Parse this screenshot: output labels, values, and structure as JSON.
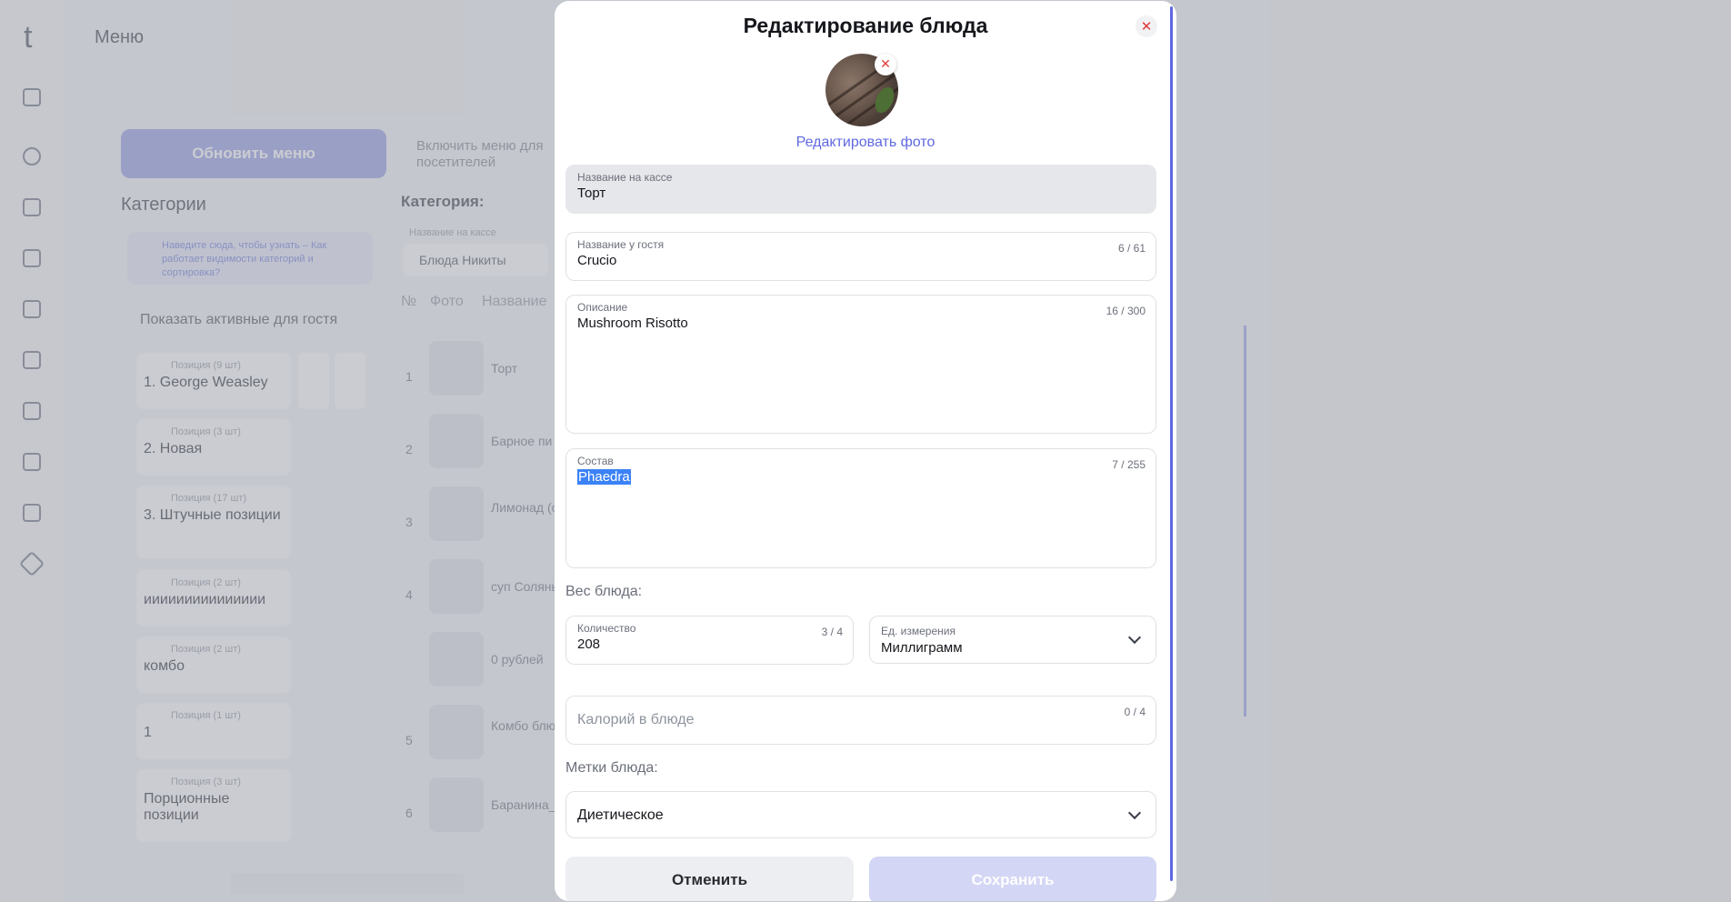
{
  "background": {
    "logo": "t",
    "page_title": "Меню",
    "refresh_button": "Обновить меню",
    "visitors_toggle_label": "Включить меню для посетителей",
    "categories_heading": "Категории",
    "category_heading": "Категория:",
    "hint_text": "Наведите сюда, чтобы узнать – Как работает видимости категорий и сортировка?",
    "show_active": "Показать активные для гостя",
    "categories": [
      {
        "sub": "Позиция (9 шт)",
        "name": "1. George Weasley"
      },
      {
        "sub": "Позиция (3 шт)",
        "name": "2. Новая"
      },
      {
        "sub": "Позиция (17 шт)",
        "name": "3. Штучные позиции"
      },
      {
        "sub": "Позиция (2 шт)",
        "name": "иииииииииииииии"
      },
      {
        "sub": "Позиция (2 шт)",
        "name": "комбо"
      },
      {
        "sub": "Позиция (1 шт)",
        "name": "1"
      },
      {
        "sub": "Позиция (3 шт)",
        "name": "Порционные позиции"
      }
    ],
    "filter_label": "Название на кассе",
    "filter_value": "Блюда Никиты",
    "columns": [
      "№",
      "Фото",
      "Название"
    ],
    "rows": [
      {
        "n": "1",
        "name": "Торт"
      },
      {
        "n": "2",
        "name": "Барное пи"
      },
      {
        "n": "3",
        "name": "Лимонад (об.пл.мор"
      },
      {
        "n": "4",
        "name": "суп Соляны"
      },
      {
        "n": "",
        "name": "0 рублей"
      },
      {
        "n": "5",
        "name": "Комбо блю общей цен"
      },
      {
        "n": "6",
        "name": "Баранина_"
      }
    ]
  },
  "modal": {
    "title": "Редактирование блюда",
    "edit_photo": "Редактировать фото",
    "cashier_name": {
      "label": "Название на кассе",
      "value": "Торт"
    },
    "guest_name": {
      "label": "Название у гостя",
      "value": "Crucio",
      "counter": "6 / 61"
    },
    "description": {
      "label": "Описание",
      "value": "Mushroom Risotto",
      "counter": "16 / 300"
    },
    "composition": {
      "label": "Состав",
      "value": "Phaedra",
      "counter": "7 / 255"
    },
    "weight_section": "Вес блюда:",
    "quantity": {
      "label": "Количество",
      "value": "208",
      "counter": "3 / 4"
    },
    "unit": {
      "label": "Ед. измерения",
      "value": "Миллиграмм"
    },
    "calories": {
      "placeholder": "Калорий в блюде",
      "counter": "0 / 4"
    },
    "tags_section": "Метки блюда:",
    "tag_value": "Диетическое",
    "cancel_button": "Отменить",
    "save_button": "Сохранить"
  }
}
